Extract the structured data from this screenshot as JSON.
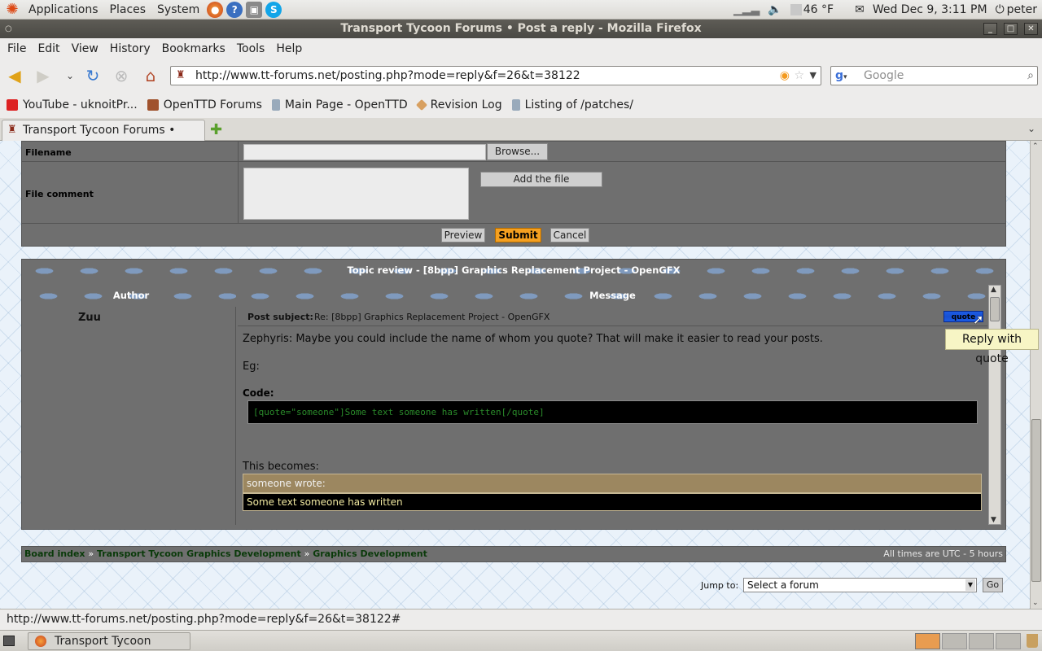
{
  "top_panel": {
    "menus": [
      "Applications",
      "Places",
      "System"
    ],
    "weather": "46 °F",
    "datetime": "Wed Dec  9,  3:11 PM",
    "user": "peter"
  },
  "window": {
    "title": "Transport Tycoon Forums • Post a reply - Mozilla Firefox"
  },
  "menubar": [
    "File",
    "Edit",
    "View",
    "History",
    "Bookmarks",
    "Tools",
    "Help"
  ],
  "nav": {
    "url": "http://www.tt-forums.net/posting.php?mode=reply&f=26&t=38122",
    "search_placeholder": "Google"
  },
  "bookmarks": [
    "YouTube - uknoitPr...",
    "OpenTTD Forums",
    "Main Page - OpenTTD",
    "Revision Log",
    "Listing of /patches/"
  ],
  "tab": {
    "title": "Transport Tycoon Forums • Post..."
  },
  "form": {
    "filename_label": "Filename",
    "browse_label": "Browse...",
    "file_comment_label": "File comment",
    "add_file_label": "Add the file",
    "preview_label": "Preview",
    "submit_label": "Submit",
    "cancel_label": "Cancel"
  },
  "topic_review": {
    "title": "Topic review - [8bpp] Graphics Replacement Project - OpenGFX",
    "author_header": "Author",
    "message_header": "Message",
    "author": "Zuu",
    "post_subject_label": "Post subject:",
    "post_subject": "Re: [8bpp] Graphics Replacement Project - OpenGFX",
    "quote_button": "quote",
    "line1": "Zephyris: Maybe you could include the name of whom you quote? That will make it easier to read your posts.",
    "line2": "Eg:",
    "code_label": "Code:",
    "code_text": "[quote=\"someone\"]Some text someone has written[/quote]",
    "becomes": "This becomes:",
    "quote_header": "someone wrote:",
    "quote_body": "Some text someone has written"
  },
  "breadcrumbs": [
    "Board index",
    "Transport Tycoon Graphics Development",
    "Graphics Development"
  ],
  "breadcrumb_sep": "»",
  "timezone": "All times are UTC - 5 hours",
  "jump": {
    "label": "Jump to:",
    "selected": "Select a forum",
    "go_label": "Go"
  },
  "tooltip": "Reply with quote",
  "status_url": "http://www.tt-forums.net/posting.php?mode=reply&f=26&t=38122#",
  "taskbar": {
    "window_label": "Transport Tycoon Foru..."
  },
  "colors": {
    "forum_blue": "#1c5ce6",
    "submit_orange": "#f5a020",
    "link_green": "#0a3a0a"
  }
}
